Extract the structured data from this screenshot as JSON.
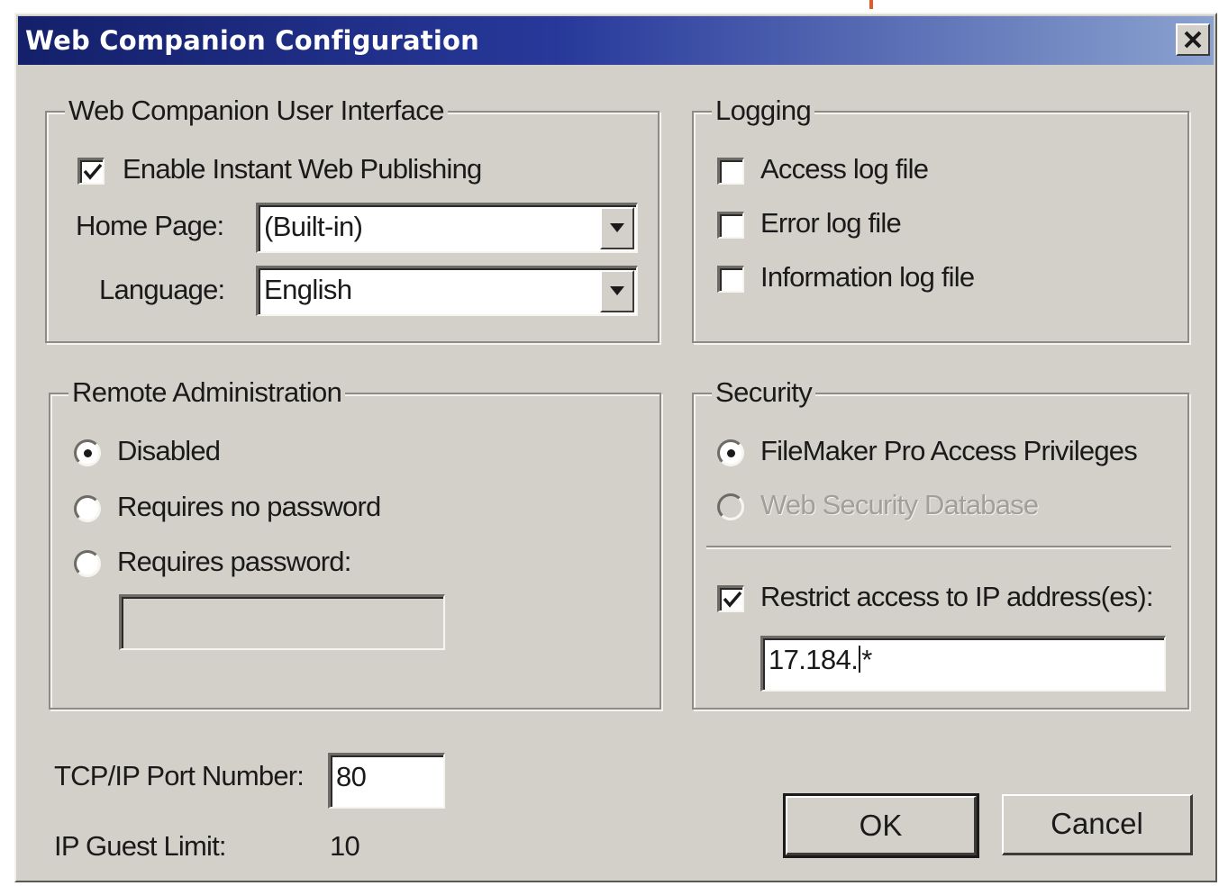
{
  "window": {
    "title": "Web Companion Configuration",
    "close_glyph": "×",
    "title_bar_color": "#1e2c80"
  },
  "user_interface": {
    "legend": "Web Companion User Interface",
    "enable_label": "Enable Instant Web Publishing",
    "enable_checked": true,
    "home_page_label": "Home Page:",
    "home_page_value": "(Built-in)",
    "language_label": "Language:",
    "language_value": "English"
  },
  "logging": {
    "legend": "Logging",
    "access_log_label": "Access log file",
    "access_log_checked": false,
    "error_log_label": "Error log file",
    "error_log_checked": false,
    "information_log_label": "Information log file",
    "information_log_checked": false
  },
  "remote_admin": {
    "legend": "Remote Administration",
    "disabled_label": "Disabled",
    "no_password_label": "Requires no password",
    "password_label": "Requires password:",
    "selected": "Disabled",
    "password_value": ""
  },
  "security": {
    "legend": "Security",
    "filemaker_label": "FileMaker Pro Access Privileges",
    "web_security_label": "Web Security Database",
    "selected": "FileMaker Pro Access Privileges",
    "restrict_label": "Restrict access to IP address(es):",
    "restrict_checked": true,
    "ip_value_before_caret": "17.184.",
    "ip_value_after_caret": "*"
  },
  "footer": {
    "port_label": "TCP/IP Port Number:",
    "port_value": "80",
    "guest_limit_label": "IP Guest Limit:",
    "guest_limit_value": "10",
    "ok_label": "OK",
    "cancel_label": "Cancel"
  }
}
